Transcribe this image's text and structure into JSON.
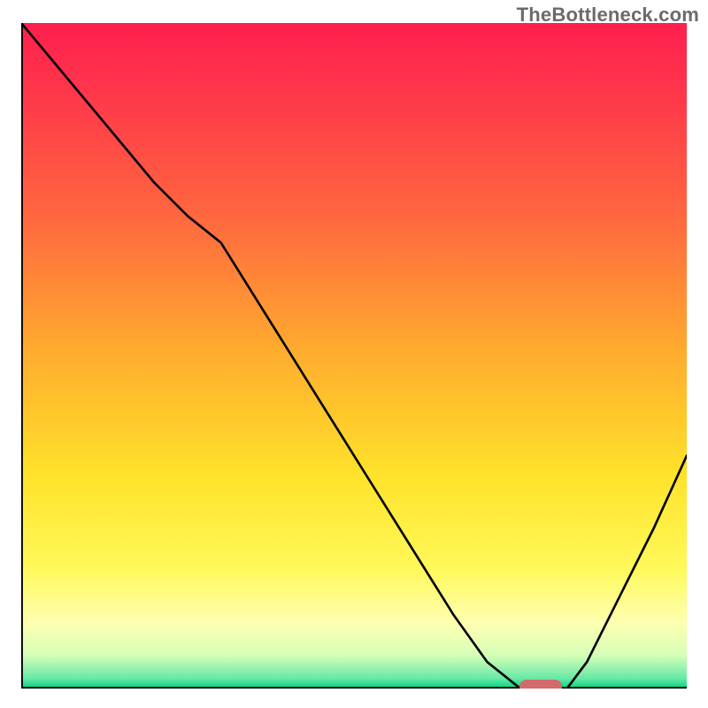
{
  "watermark": "TheBottleneck.com",
  "chart_data": {
    "type": "line",
    "title": "",
    "xlabel": "",
    "ylabel": "",
    "xlim": [
      0,
      100
    ],
    "ylim": [
      0,
      100
    ],
    "x": [
      0,
      5,
      10,
      15,
      20,
      25,
      30,
      35,
      40,
      45,
      50,
      55,
      60,
      65,
      70,
      75,
      80,
      82,
      85,
      90,
      95,
      100
    ],
    "values": [
      100,
      94,
      88,
      82,
      76,
      71,
      67,
      59,
      51,
      43,
      35,
      27,
      19,
      11,
      4,
      0,
      0,
      0,
      4,
      14,
      24,
      35
    ],
    "gradient_stops": [
      {
        "pos": 0.0,
        "color": "#ff1f4d"
      },
      {
        "pos": 0.12,
        "color": "#ff3a4a"
      },
      {
        "pos": 0.3,
        "color": "#ff6a3e"
      },
      {
        "pos": 0.5,
        "color": "#ffae2e"
      },
      {
        "pos": 0.68,
        "color": "#ffe22a"
      },
      {
        "pos": 0.82,
        "color": "#fff95a"
      },
      {
        "pos": 0.9,
        "color": "#ffffb0"
      },
      {
        "pos": 0.95,
        "color": "#d6ffb8"
      },
      {
        "pos": 0.985,
        "color": "#66e9a6"
      },
      {
        "pos": 1.0,
        "color": "#00d37a"
      }
    ],
    "marker": {
      "x": 78,
      "y": 0,
      "color": "#d46a6a"
    }
  }
}
